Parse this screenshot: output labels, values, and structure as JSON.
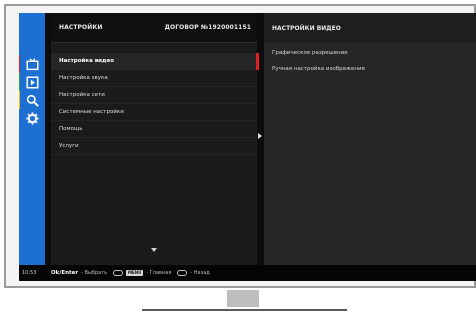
{
  "settings": {
    "header_title": "НАСТРОЙКИ",
    "contract_label": "ДОГОВОР №1920001151",
    "menu_items": [
      "Настройка видео",
      "Настройка звука",
      "Настройка сети",
      "Системные настройки",
      "Помощь",
      "Услуги"
    ],
    "selected_index": 0
  },
  "video_settings": {
    "header_title": "НАСТРОЙКИ ВИДЕО",
    "items": [
      "Графическое разрешение",
      "Ручная настройка изображения"
    ]
  },
  "rail": {
    "icons": [
      "tv-icon",
      "play-icon",
      "search-icon",
      "gear-icon"
    ],
    "marker_colors": [
      "#e02020",
      "#2aa84a",
      "#f2c200"
    ]
  },
  "statusbar": {
    "clock": "10:53",
    "ok_label": "Ok/Enter",
    "ok_action": "- Выбрать",
    "menu_badge": "MENU",
    "menu_action": "- Главная",
    "back_action": "- Назад"
  },
  "colors": {
    "rail": "#1d6fd1",
    "selection_bar": "#e02020"
  }
}
